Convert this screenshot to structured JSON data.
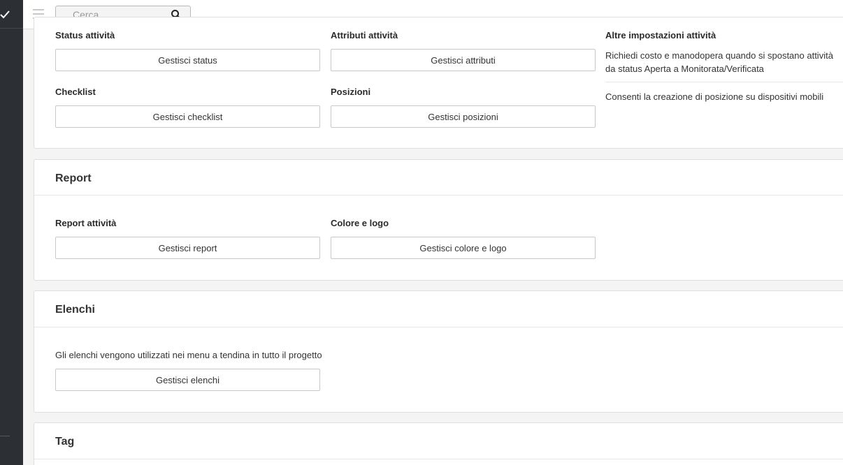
{
  "search": {
    "placeholder": "Cerca"
  },
  "activities": {
    "status_label": "Status attività",
    "status_button": "Gestisci status",
    "attributes_label": "Attributi attività",
    "attributes_button": "Gestisci attributi",
    "other_settings_label": "Altre impostazioni attività",
    "other_setting_1": "Richiedi costo e manodopera quando si spostano attività da status Aperta a Monitorata/Verificata",
    "other_setting_2": "Consenti la creazione di posizione su dispositivi mobili",
    "checklist_label": "Checklist",
    "checklist_button": "Gestisci checklist",
    "positions_label": "Posizioni",
    "positions_button": "Gestisci posizioni"
  },
  "report": {
    "title": "Report",
    "report_label": "Report attività",
    "report_button": "Gestisci report",
    "color_logo_label": "Colore e logo",
    "color_logo_button": "Gestisci colore e logo"
  },
  "lists": {
    "title": "Elenchi",
    "description": "Gli elenchi vengono utilizzati nei menu a tendina in tutto il progetto",
    "button": "Gestisci elenchi"
  },
  "tags": {
    "title": "Tag"
  }
}
